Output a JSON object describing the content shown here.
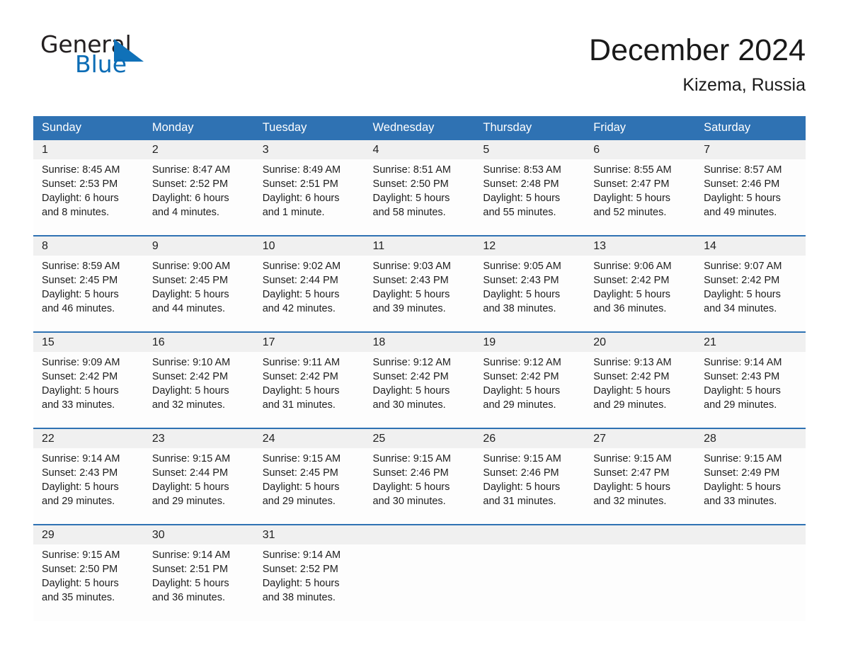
{
  "brand": {
    "name_part1": "General",
    "name_part2": "Blue",
    "triangle_color": "#1071b8",
    "blue_color": "#0b6cb5"
  },
  "header": {
    "title": "December 2024",
    "location": "Kizema, Russia"
  },
  "theme": {
    "header_blue": "#2f72b3",
    "daynum_gray": "#f0f0f0",
    "cell_white": "#fdfdfd"
  },
  "weekday_headers": [
    "Sunday",
    "Monday",
    "Tuesday",
    "Wednesday",
    "Thursday",
    "Friday",
    "Saturday"
  ],
  "weeks": [
    {
      "days": [
        {
          "num": "1",
          "sunrise": "Sunrise: 8:45 AM",
          "sunset": "Sunset: 2:53 PM",
          "daylight1": "Daylight: 6 hours",
          "daylight2": "and 8 minutes."
        },
        {
          "num": "2",
          "sunrise": "Sunrise: 8:47 AM",
          "sunset": "Sunset: 2:52 PM",
          "daylight1": "Daylight: 6 hours",
          "daylight2": "and 4 minutes."
        },
        {
          "num": "3",
          "sunrise": "Sunrise: 8:49 AM",
          "sunset": "Sunset: 2:51 PM",
          "daylight1": "Daylight: 6 hours",
          "daylight2": "and 1 minute."
        },
        {
          "num": "4",
          "sunrise": "Sunrise: 8:51 AM",
          "sunset": "Sunset: 2:50 PM",
          "daylight1": "Daylight: 5 hours",
          "daylight2": "and 58 minutes."
        },
        {
          "num": "5",
          "sunrise": "Sunrise: 8:53 AM",
          "sunset": "Sunset: 2:48 PM",
          "daylight1": "Daylight: 5 hours",
          "daylight2": "and 55 minutes."
        },
        {
          "num": "6",
          "sunrise": "Sunrise: 8:55 AM",
          "sunset": "Sunset: 2:47 PM",
          "daylight1": "Daylight: 5 hours",
          "daylight2": "and 52 minutes."
        },
        {
          "num": "7",
          "sunrise": "Sunrise: 8:57 AM",
          "sunset": "Sunset: 2:46 PM",
          "daylight1": "Daylight: 5 hours",
          "daylight2": "and 49 minutes."
        }
      ]
    },
    {
      "days": [
        {
          "num": "8",
          "sunrise": "Sunrise: 8:59 AM",
          "sunset": "Sunset: 2:45 PM",
          "daylight1": "Daylight: 5 hours",
          "daylight2": "and 46 minutes."
        },
        {
          "num": "9",
          "sunrise": "Sunrise: 9:00 AM",
          "sunset": "Sunset: 2:45 PM",
          "daylight1": "Daylight: 5 hours",
          "daylight2": "and 44 minutes."
        },
        {
          "num": "10",
          "sunrise": "Sunrise: 9:02 AM",
          "sunset": "Sunset: 2:44 PM",
          "daylight1": "Daylight: 5 hours",
          "daylight2": "and 42 minutes."
        },
        {
          "num": "11",
          "sunrise": "Sunrise: 9:03 AM",
          "sunset": "Sunset: 2:43 PM",
          "daylight1": "Daylight: 5 hours",
          "daylight2": "and 39 minutes."
        },
        {
          "num": "12",
          "sunrise": "Sunrise: 9:05 AM",
          "sunset": "Sunset: 2:43 PM",
          "daylight1": "Daylight: 5 hours",
          "daylight2": "and 38 minutes."
        },
        {
          "num": "13",
          "sunrise": "Sunrise: 9:06 AM",
          "sunset": "Sunset: 2:42 PM",
          "daylight1": "Daylight: 5 hours",
          "daylight2": "and 36 minutes."
        },
        {
          "num": "14",
          "sunrise": "Sunrise: 9:07 AM",
          "sunset": "Sunset: 2:42 PM",
          "daylight1": "Daylight: 5 hours",
          "daylight2": "and 34 minutes."
        }
      ]
    },
    {
      "days": [
        {
          "num": "15",
          "sunrise": "Sunrise: 9:09 AM",
          "sunset": "Sunset: 2:42 PM",
          "daylight1": "Daylight: 5 hours",
          "daylight2": "and 33 minutes."
        },
        {
          "num": "16",
          "sunrise": "Sunrise: 9:10 AM",
          "sunset": "Sunset: 2:42 PM",
          "daylight1": "Daylight: 5 hours",
          "daylight2": "and 32 minutes."
        },
        {
          "num": "17",
          "sunrise": "Sunrise: 9:11 AM",
          "sunset": "Sunset: 2:42 PM",
          "daylight1": "Daylight: 5 hours",
          "daylight2": "and 31 minutes."
        },
        {
          "num": "18",
          "sunrise": "Sunrise: 9:12 AM",
          "sunset": "Sunset: 2:42 PM",
          "daylight1": "Daylight: 5 hours",
          "daylight2": "and 30 minutes."
        },
        {
          "num": "19",
          "sunrise": "Sunrise: 9:12 AM",
          "sunset": "Sunset: 2:42 PM",
          "daylight1": "Daylight: 5 hours",
          "daylight2": "and 29 minutes."
        },
        {
          "num": "20",
          "sunrise": "Sunrise: 9:13 AM",
          "sunset": "Sunset: 2:42 PM",
          "daylight1": "Daylight: 5 hours",
          "daylight2": "and 29 minutes."
        },
        {
          "num": "21",
          "sunrise": "Sunrise: 9:14 AM",
          "sunset": "Sunset: 2:43 PM",
          "daylight1": "Daylight: 5 hours",
          "daylight2": "and 29 minutes."
        }
      ]
    },
    {
      "days": [
        {
          "num": "22",
          "sunrise": "Sunrise: 9:14 AM",
          "sunset": "Sunset: 2:43 PM",
          "daylight1": "Daylight: 5 hours",
          "daylight2": "and 29 minutes."
        },
        {
          "num": "23",
          "sunrise": "Sunrise: 9:15 AM",
          "sunset": "Sunset: 2:44 PM",
          "daylight1": "Daylight: 5 hours",
          "daylight2": "and 29 minutes."
        },
        {
          "num": "24",
          "sunrise": "Sunrise: 9:15 AM",
          "sunset": "Sunset: 2:45 PM",
          "daylight1": "Daylight: 5 hours",
          "daylight2": "and 29 minutes."
        },
        {
          "num": "25",
          "sunrise": "Sunrise: 9:15 AM",
          "sunset": "Sunset: 2:46 PM",
          "daylight1": "Daylight: 5 hours",
          "daylight2": "and 30 minutes."
        },
        {
          "num": "26",
          "sunrise": "Sunrise: 9:15 AM",
          "sunset": "Sunset: 2:46 PM",
          "daylight1": "Daylight: 5 hours",
          "daylight2": "and 31 minutes."
        },
        {
          "num": "27",
          "sunrise": "Sunrise: 9:15 AM",
          "sunset": "Sunset: 2:47 PM",
          "daylight1": "Daylight: 5 hours",
          "daylight2": "and 32 minutes."
        },
        {
          "num": "28",
          "sunrise": "Sunrise: 9:15 AM",
          "sunset": "Sunset: 2:49 PM",
          "daylight1": "Daylight: 5 hours",
          "daylight2": "and 33 minutes."
        }
      ]
    },
    {
      "days": [
        {
          "num": "29",
          "sunrise": "Sunrise: 9:15 AM",
          "sunset": "Sunset: 2:50 PM",
          "daylight1": "Daylight: 5 hours",
          "daylight2": "and 35 minutes."
        },
        {
          "num": "30",
          "sunrise": "Sunrise: 9:14 AM",
          "sunset": "Sunset: 2:51 PM",
          "daylight1": "Daylight: 5 hours",
          "daylight2": "and 36 minutes."
        },
        {
          "num": "31",
          "sunrise": "Sunrise: 9:14 AM",
          "sunset": "Sunset: 2:52 PM",
          "daylight1": "Daylight: 5 hours",
          "daylight2": "and 38 minutes."
        },
        {
          "num": "",
          "sunrise": "",
          "sunset": "",
          "daylight1": "",
          "daylight2": ""
        },
        {
          "num": "",
          "sunrise": "",
          "sunset": "",
          "daylight1": "",
          "daylight2": ""
        },
        {
          "num": "",
          "sunrise": "",
          "sunset": "",
          "daylight1": "",
          "daylight2": ""
        },
        {
          "num": "",
          "sunrise": "",
          "sunset": "",
          "daylight1": "",
          "daylight2": ""
        }
      ]
    }
  ]
}
